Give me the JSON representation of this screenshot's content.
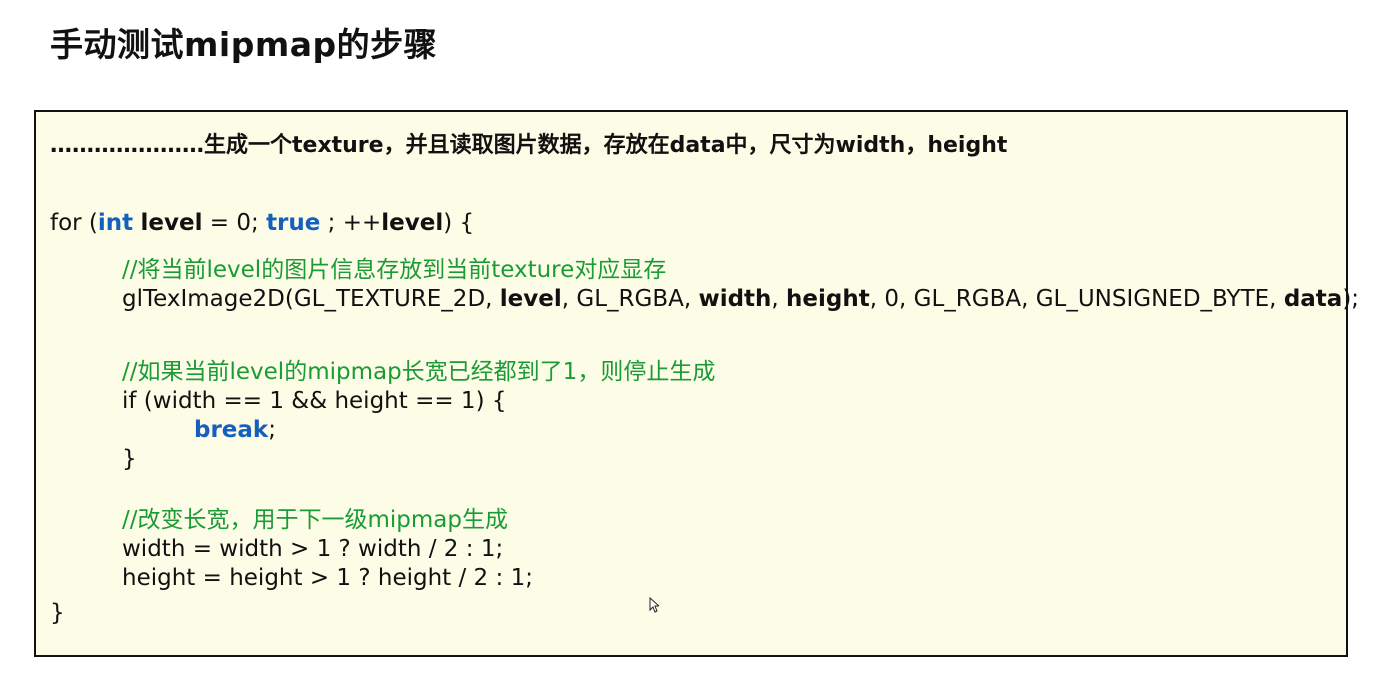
{
  "page": {
    "title": "手动测试mipmap的步骤"
  },
  "code": {
    "intro": "…………………生成一个texture，并且读取图片数据，存放在data中，尺寸为width，height",
    "for_line": {
      "p1": "for (",
      "kw_int": "int",
      "sp1": " ",
      "var_level": "level",
      "p2": " = 0; ",
      "kw_true": "true",
      "p3": " ; ++",
      "var_level2": "level",
      "p4": ") {"
    },
    "comment1": "//将当前level的图片信息存放到当前texture对应显存",
    "glcall": {
      "p1": "glTexImage2D(GL_TEXTURE_2D, ",
      "a_level": "level",
      "p2": ", GL_RGBA, ",
      "a_width": "width",
      "p3": ", ",
      "a_height": "height",
      "p4": ", 0, GL_RGBA, GL_UNSIGNED_BYTE, ",
      "a_data": "data",
      "p5": ");"
    },
    "comment2": "//如果当前level的mipmap长宽已经都到了1，则停止生成",
    "if_line": "if (width == 1 && height == 1) {",
    "break_kw": "break",
    "break_semi": ";",
    "if_close": "}",
    "comment3": "//改变长宽，用于下一级mipmap生成",
    "width_line": "width = width > 1 ? width / 2 : 1;",
    "height_line": "height = height > 1 ? height / 2 : 1;",
    "for_close": "}"
  },
  "colors": {
    "keyword": "#1560bd",
    "comment": "#1a9b35",
    "box_background": "#fdfde7"
  },
  "icons": {
    "mouse_cursor": "mouse-pointer-icon"
  }
}
